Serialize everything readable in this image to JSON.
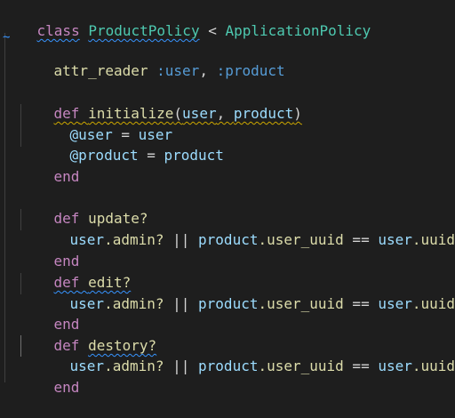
{
  "code": {
    "line1": {
      "kw": "class",
      "name": "ProductPolicy",
      "lt": "<",
      "parent": "ApplicationPolicy"
    },
    "marker": "~",
    "line2": {
      "fn": "attr_reader",
      "sym1": ":user",
      "comma": ",",
      "sym2": ":product"
    },
    "line3": {
      "kw": "def",
      "fn": "initialize",
      "open": "(",
      "p1": "user",
      "comma": ", ",
      "p2": "product",
      "close": ")"
    },
    "line4": {
      "ivar": "@user",
      "eq": " = ",
      "val": "user"
    },
    "line5": {
      "ivar": "@product",
      "eq": " = ",
      "val": "product"
    },
    "line6": {
      "kw": "end"
    },
    "line7": {
      "kw": "def",
      "fn": "update?"
    },
    "line8": {
      "a": "user",
      "b": ".admin?",
      "c": " || ",
      "d": "product",
      "e": ".user_uuid",
      "f": " == ",
      "g": "user",
      "h": ".uuid"
    },
    "line9": {
      "kw": "end"
    },
    "line10": {
      "kw": "def",
      "fn": "edit?"
    },
    "line11": {
      "a": "user",
      "b": ".admin?",
      "c": " || ",
      "d": "product",
      "e": ".user_uuid",
      "f": " == ",
      "g": "user",
      "h": ".uuid"
    },
    "line12": {
      "kw": "end"
    },
    "line13": {
      "kw": "def",
      "fn": "destory?"
    },
    "line14": {
      "a": "user",
      "b": ".admin?",
      "c": " || ",
      "d": "product",
      "e": ".user_uuid",
      "f": " == ",
      "g": "user",
      "h": ".uuid"
    },
    "line15": {
      "kw": "end"
    }
  }
}
